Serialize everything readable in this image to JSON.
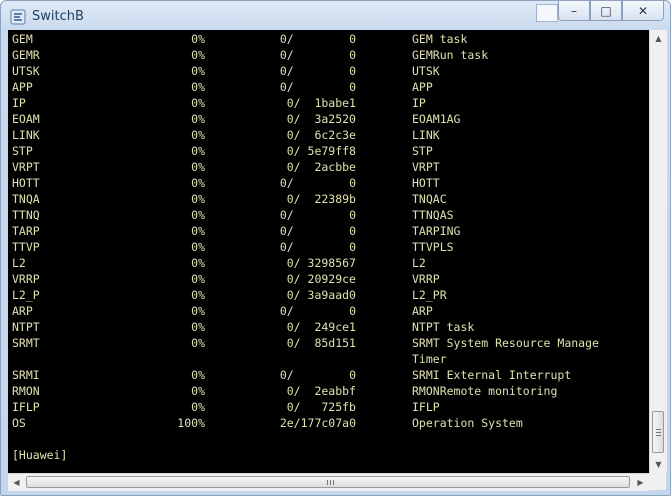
{
  "window": {
    "title": "SwitchB"
  },
  "controls": {
    "minimize": "–",
    "maximize": "□",
    "close": "✕"
  },
  "rows": [
    {
      "name": "GEM",
      "pct": "0%",
      "val": "0/        0",
      "desc": "GEM task"
    },
    {
      "name": "GEMR",
      "pct": "0%",
      "val": "0/        0",
      "desc": "GEMRun task"
    },
    {
      "name": "UTSK",
      "pct": "0%",
      "val": "0/        0",
      "desc": "UTSK"
    },
    {
      "name": "APP",
      "pct": "0%",
      "val": "0/        0",
      "desc": "APP"
    },
    {
      "name": "IP",
      "pct": "0%",
      "val": "0/  1babe1",
      "desc": "IP"
    },
    {
      "name": "EOAM",
      "pct": "0%",
      "val": "0/  3a2520",
      "desc": "EOAM1AG"
    },
    {
      "name": "LINK",
      "pct": "0%",
      "val": "0/  6c2c3e",
      "desc": "LINK"
    },
    {
      "name": "STP",
      "pct": "0%",
      "val": "0/ 5e79ff8",
      "desc": "STP"
    },
    {
      "name": "VRPT",
      "pct": "0%",
      "val": "0/  2acbbe",
      "desc": "VRPT"
    },
    {
      "name": "HOTT",
      "pct": "0%",
      "val": "0/        0",
      "desc": "HOTT"
    },
    {
      "name": "TNQA",
      "pct": "0%",
      "val": "0/  22389b",
      "desc": "TNQAC"
    },
    {
      "name": "TTNQ",
      "pct": "0%",
      "val": "0/        0",
      "desc": "TTNQAS"
    },
    {
      "name": "TARP",
      "pct": "0%",
      "val": "0/        0",
      "desc": "TARPING"
    },
    {
      "name": "TTVP",
      "pct": "0%",
      "val": "0/        0",
      "desc": "TTVPLS"
    },
    {
      "name": "L2",
      "pct": "0%",
      "val": "0/ 3298567",
      "desc": "L2"
    },
    {
      "name": "VRRP",
      "pct": "0%",
      "val": "0/ 20929ce",
      "desc": "VRRP"
    },
    {
      "name": "L2_P",
      "pct": "0%",
      "val": "0/ 3a9aad0",
      "desc": "L2_PR"
    },
    {
      "name": "ARP",
      "pct": "0%",
      "val": "0/        0",
      "desc": "ARP"
    },
    {
      "name": "NTPT",
      "pct": "0%",
      "val": "0/  249ce1",
      "desc": "NTPT task"
    },
    {
      "name": "SRMT",
      "pct": "0%",
      "val": "0/  85d151",
      "desc": "SRMT System Resource Manage"
    },
    {
      "name": "",
      "pct": "",
      "val": "",
      "desc": "Timer"
    },
    {
      "name": "SRMI",
      "pct": "0%",
      "val": "0/        0",
      "desc": "SRMI External Interrupt"
    },
    {
      "name": "RMON",
      "pct": "0%",
      "val": "0/  2eabbf",
      "desc": "RMONRemote monitoring"
    },
    {
      "name": "IFLP",
      "pct": "0%",
      "val": "0/   725fb",
      "desc": "IFLP"
    },
    {
      "name": "OS",
      "pct": "100%",
      "val": "2e/177c07a0",
      "desc": "Operation System"
    }
  ],
  "prompt": "[Huawei]",
  "scrollbars": {
    "up": "▲",
    "down": "▼",
    "left": "◀",
    "right": "▶"
  }
}
